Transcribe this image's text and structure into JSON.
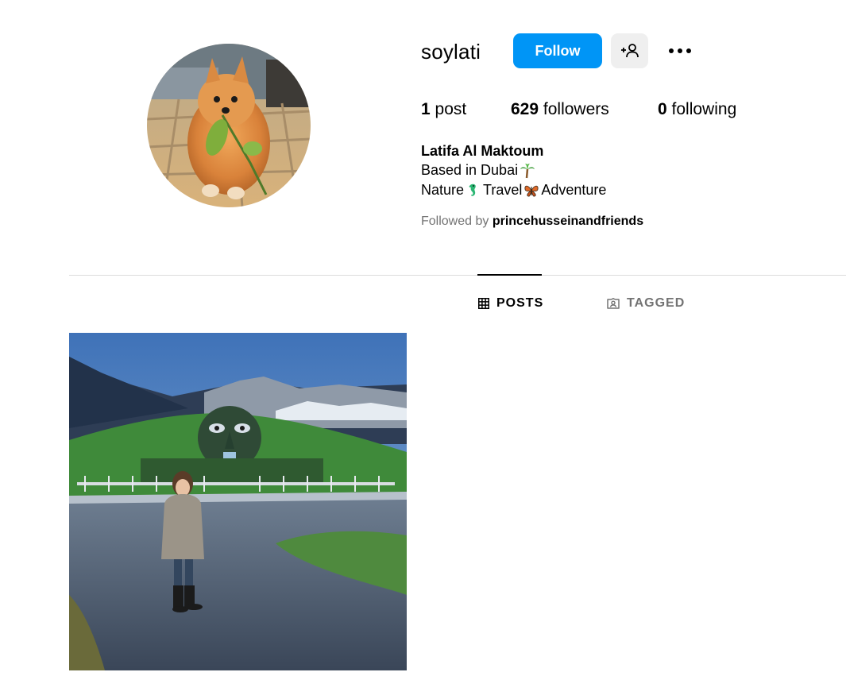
{
  "profile": {
    "username": "soylati",
    "follow_label": "Follow",
    "stats": {
      "posts_count": "1",
      "posts_label": "post",
      "followers_count": "629",
      "followers_label": "followers",
      "following_count": "0",
      "following_label": "following"
    },
    "full_name": "Latifa Al Maktoum",
    "bio_line1_text": "Based in Dubai",
    "bio_line1_emoji": "palm-tree-icon",
    "bio_line2": {
      "part1": "Nature",
      "emoji1": "seahorse-icon",
      "part2": "Travel",
      "emoji2": "butterfly-icon",
      "part3": "Adventure"
    },
    "followed_by_prefix": "Followed by",
    "followed_by_name": "princehusseinandfriends"
  },
  "tabs": [
    {
      "label": "POSTS",
      "icon": "grid-icon",
      "active": true
    },
    {
      "label": "TAGGED",
      "icon": "tagged-icon",
      "active": false
    }
  ],
  "posts": [
    {
      "id": "post-1",
      "thumbnail": "photo-woman-standing-before-garden-giant-head"
    }
  ],
  "colors": {
    "accent": "#0095f6",
    "secondary_button": "#efefef",
    "muted_text": "#737373",
    "divider": "#dbdbdb"
  }
}
